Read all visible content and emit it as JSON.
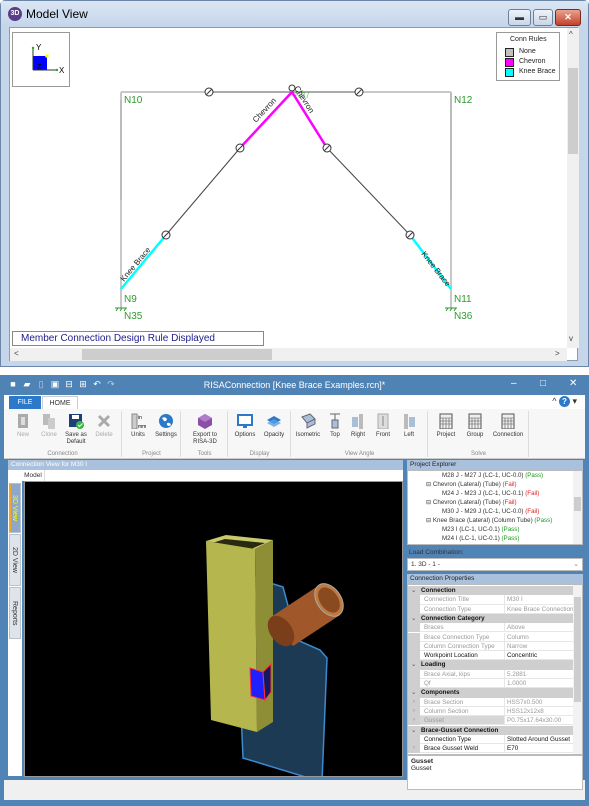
{
  "model_view": {
    "title": "Model View",
    "title_icon": "3d-icon",
    "window_controls": [
      "minimize",
      "maximize",
      "close"
    ],
    "axes": {
      "y": "Y",
      "x": "X",
      "z": "Z"
    },
    "legend": {
      "title": "Conn Rules",
      "items": [
        {
          "label": "None",
          "color": "#c0c0c0"
        },
        {
          "label": "Chevron",
          "color": "#ff00ff"
        },
        {
          "label": "Knee Brace",
          "color": "#00ffff"
        }
      ]
    },
    "nodes": [
      "N10",
      "N37",
      "N12",
      "N9",
      "N35",
      "N11",
      "N36"
    ],
    "member_labels": {
      "chevron_left": "Chevron",
      "chevron_right": "Chevron",
      "knee_left": "Knee Brace",
      "knee_right": "Knee Brace"
    },
    "status_message": "Member Connection Design Rule Displayed",
    "colors": {
      "node_label": "#2e9a2e",
      "chevron": "#ff00ff",
      "knee_brace": "#00ffff",
      "none": "#c0c0c0"
    }
  },
  "risa": {
    "title": "RISAConnection [Knee Brace Examples.rcn]*",
    "quick_access": [
      "new-icon",
      "open-icon",
      "clone-icon",
      "save-icon",
      "print-icon",
      "print-preview-icon",
      "undo-icon",
      "redo-icon"
    ],
    "tabs": {
      "file": "FILE",
      "home": "HOME"
    },
    "ribbon": {
      "groups": [
        {
          "name": "Connection",
          "buttons": [
            {
              "label": "New",
              "enabled": false
            },
            {
              "label": "Clone",
              "enabled": false
            },
            {
              "label": "Save as Default",
              "enabled": true
            },
            {
              "label": "Delete",
              "enabled": false
            }
          ]
        },
        {
          "name": "Project",
          "buttons": [
            {
              "label": "Units",
              "enabled": true
            },
            {
              "label": "Settings",
              "enabled": true
            }
          ]
        },
        {
          "name": "Tools",
          "buttons": [
            {
              "label": "Export to RISA-3D",
              "enabled": true
            }
          ]
        },
        {
          "name": "Display",
          "buttons": [
            {
              "label": "Options",
              "enabled": true
            },
            {
              "label": "Opacity",
              "enabled": true
            }
          ]
        },
        {
          "name": "View Angle",
          "buttons": [
            {
              "label": "Isometric",
              "enabled": true
            },
            {
              "label": "Top",
              "enabled": true
            },
            {
              "label": "Right",
              "enabled": true
            },
            {
              "label": "Front",
              "enabled": true
            },
            {
              "label": "Left",
              "enabled": true
            }
          ]
        },
        {
          "name": "Solve",
          "buttons": [
            {
              "label": "Project",
              "enabled": true
            },
            {
              "label": "Group",
              "enabled": true
            },
            {
              "label": "Connection",
              "enabled": true
            }
          ]
        }
      ]
    },
    "connection_view": {
      "title": "Connection View for M30 I",
      "subtab": "Model",
      "side_tabs": [
        "3D View",
        "2D View",
        "Reports"
      ],
      "active_side_tab": "3D View"
    },
    "project_explorer": {
      "title": "Project Explorer",
      "items": [
        {
          "level": 2,
          "text": "M28 J - M27 J (LC-1, UC-0.0)",
          "status": "(Pass)"
        },
        {
          "level": 1,
          "text": "Chevron (Lateral) (Tube)",
          "status": "(Fail)"
        },
        {
          "level": 2,
          "text": "M24 J - M23 J (LC-1, UC-0.1)",
          "status": "(Fail)"
        },
        {
          "level": 1,
          "text": "Chevron (Lateral) (Tube)",
          "status": "(Fail)"
        },
        {
          "level": 2,
          "text": "M30 J - M29 J (LC-1, UC-0.0)",
          "status": "(Fail)"
        },
        {
          "level": 1,
          "text": "Knee Brace (Lateral) (Column Tube)",
          "status": "(Pass)"
        },
        {
          "level": 2,
          "text": "M23 I (LC-1, UC-0.1)",
          "status": "(Pass)"
        },
        {
          "level": 2,
          "text": "M24 I (LC-1, UC-0.1)",
          "status": "(Pass)"
        }
      ]
    },
    "load_combination": {
      "label": "Load Combination:",
      "value": "1. 3D - 1 -"
    },
    "connection_properties": {
      "title": "Connection Properties",
      "rows": [
        {
          "type": "cat",
          "name": "Connection"
        },
        {
          "type": "prop",
          "key": "Connection Title",
          "value": "M30 I",
          "editable": false
        },
        {
          "type": "prop",
          "key": "Connection Type",
          "value": "Knee Brace Connection",
          "editable": false
        },
        {
          "type": "cat",
          "name": "Connection Category"
        },
        {
          "type": "prop",
          "key": "Braces",
          "value": "Above",
          "editable": false
        },
        {
          "type": "prop",
          "key": "Brace Connection Type",
          "value": "Column",
          "editable": false
        },
        {
          "type": "prop",
          "key": "Column Connection Type",
          "value": "Narrow",
          "editable": false
        },
        {
          "type": "prop",
          "key": "Workpoint Location",
          "value": "Concentric",
          "editable": true
        },
        {
          "type": "cat",
          "name": "Loading"
        },
        {
          "type": "prop",
          "key": "Brace Axial, kips",
          "value": "5.2881",
          "editable": false
        },
        {
          "type": "prop",
          "key": "Qf",
          "value": "1.0000",
          "editable": false
        },
        {
          "type": "cat",
          "name": "Components"
        },
        {
          "type": "prop",
          "key": "Brace Section",
          "value": "HSS7x0.500",
          "editable": false,
          "expandable": true
        },
        {
          "type": "prop",
          "key": "Column Section",
          "value": "HSS12x12x8",
          "editable": false,
          "expandable": true
        },
        {
          "type": "prop",
          "key": "Gusset",
          "value": "P0.75x17.64x30.00",
          "editable": false,
          "expandable": true,
          "selected": true
        },
        {
          "type": "cat",
          "name": "Brace-Gusset Connection"
        },
        {
          "type": "prop",
          "key": "Connection Type",
          "value": "Slotted Around Gusset",
          "editable": true
        },
        {
          "type": "prop",
          "key": "Brace Gusset Weld",
          "value": "E70",
          "editable": true,
          "expandable": true
        }
      ]
    },
    "description": {
      "title": "Gusset",
      "text": "Gusset"
    }
  }
}
